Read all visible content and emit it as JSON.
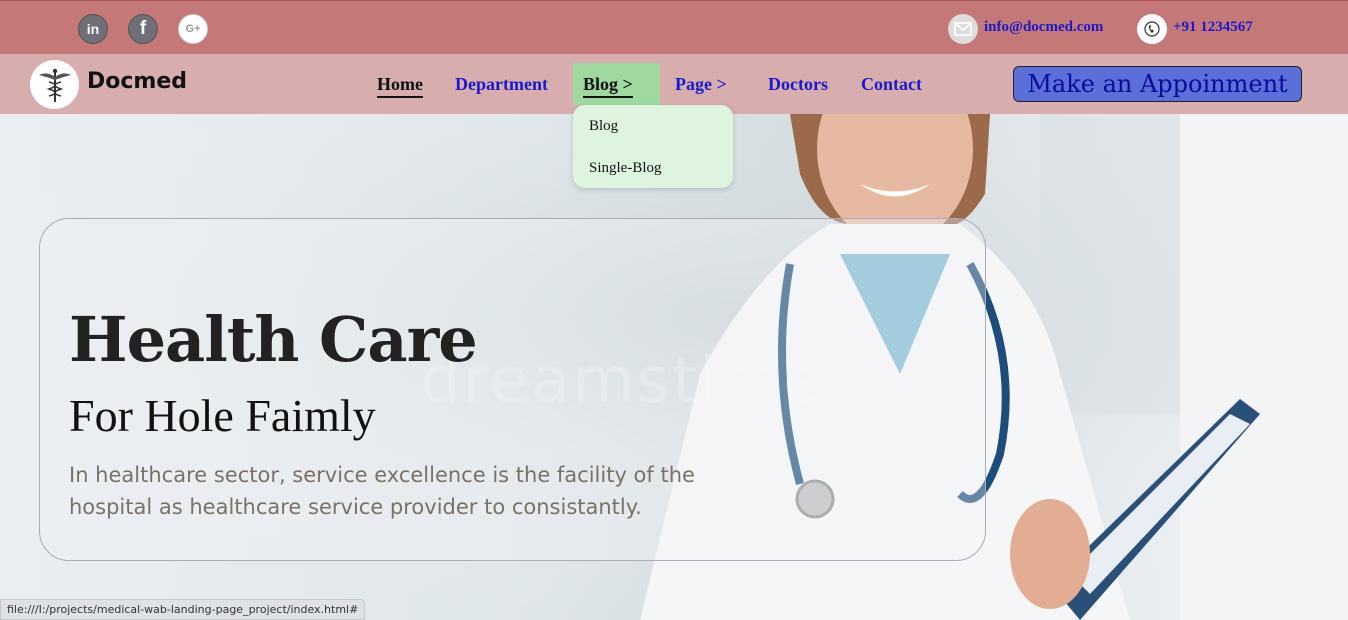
{
  "topbar": {
    "social": [
      {
        "icon": "linkedin-icon",
        "glyph": "in"
      },
      {
        "icon": "facebook-icon",
        "glyph": "f"
      },
      {
        "icon": "google-plus-icon",
        "glyph": "G+"
      }
    ],
    "email": "info@docmed.com",
    "phone": "+91 1234567"
  },
  "nav": {
    "brand": "Docmed",
    "items": [
      "Home",
      "Department",
      "Blog >",
      "Page >",
      "Doctors",
      "Contact"
    ],
    "cta": "Make an Appoinment"
  },
  "dropdown": {
    "items": [
      "Blog",
      "Single-Blog"
    ]
  },
  "hero": {
    "title": "Health Care",
    "subtitle": "For Hole Faimly",
    "description": "In healthcare sector, service excellence is the facility of the hospital as healthcare service provider to consistantly.",
    "watermark": "dreamstime."
  },
  "status": {
    "url": "file:///I:/projects/medical-wab-landing-page_project/index.html#"
  },
  "colors": {
    "topbar": "#c47878",
    "navbar": "#d7adad",
    "link": "#1a1acc",
    "active_bg": "#9fd9a0",
    "dropdown_bg": "#dff4df",
    "cta_bg": "#5b6fd8"
  }
}
